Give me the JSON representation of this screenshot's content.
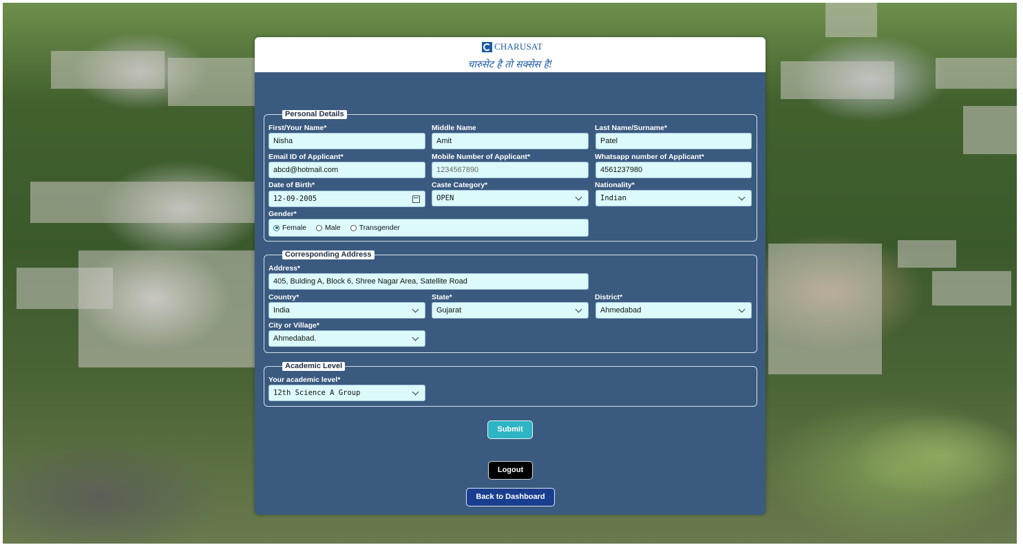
{
  "header": {
    "logo_text": "CHARUSAT",
    "tagline": "चारुसेट है तो सक्सेस है!"
  },
  "personal": {
    "legend": "Personal Details",
    "first_name_label": "First/Your Name*",
    "first_name": "Nisha",
    "middle_name_label": "Middle Name",
    "middle_name": "Amit",
    "last_name_label": "Last Name/Surname*",
    "last_name": "Patel",
    "email_label": "Email ID of Applicant*",
    "email": "abcd@hotmail.com",
    "mobile_label": "Mobile Number of Applicant*",
    "mobile": "1234567890",
    "whatsapp_label": "Whatsapp number of Applicant*",
    "whatsapp": "4561237980",
    "dob_label": "Date of Birth*",
    "dob": "12-09-2005",
    "caste_label": "Caste Category*",
    "caste": "OPEN",
    "nationality_label": "Nationality*",
    "nationality": "Indian",
    "gender_label": "Gender*",
    "gender_options": [
      "Female",
      "Male",
      "Transgender"
    ],
    "gender_selected": "Female"
  },
  "address": {
    "legend": "Corresponding Address",
    "address_label": "Address*",
    "address": "405, Bulding A, Block 6, Shree Nagar Area, Satellite Road",
    "country_label": "Country*",
    "country": "India",
    "state_label": "State*",
    "state": "Gujarat",
    "district_label": "District*",
    "district": "Ahmedabad",
    "city_label": "City or Village*",
    "city": "Ahmedabad."
  },
  "academic": {
    "legend": "Academic Level",
    "level_label": "Your academic level*",
    "level": "12th Science A Group"
  },
  "buttons": {
    "submit": "Submit",
    "logout": "Logout",
    "dashboard": "Back to Dashboard"
  }
}
